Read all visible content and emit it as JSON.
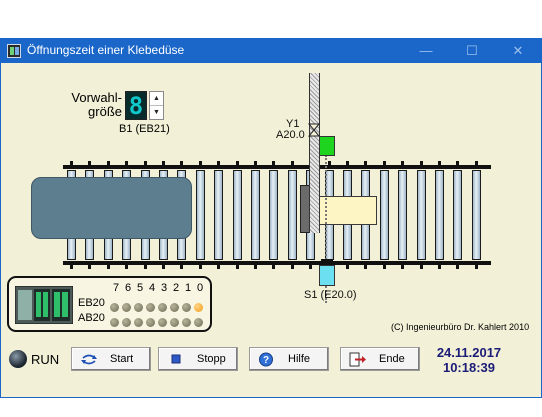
{
  "window": {
    "title": "Öffnungszeit einer Klebedüse",
    "controls": {
      "minimize": "—",
      "maximize": "☐",
      "close": "✕"
    }
  },
  "preset": {
    "label_line1": "Vorwahl-",
    "label_line2": "größe",
    "display_value": "8",
    "spin_up": "▲",
    "spin_down": "▼",
    "input_label": "B1 (EB21)"
  },
  "valve": {
    "name": "Y1",
    "address": "A20.0",
    "lamp_color": "#1fd41f"
  },
  "sensor": {
    "label": "S1 (E20.0)",
    "lamp_color": "#6ce0f0"
  },
  "plc_panel": {
    "bit_labels": [
      "7",
      "6",
      "5",
      "4",
      "3",
      "2",
      "1",
      "0"
    ],
    "rows": [
      {
        "label": "EB20",
        "bits": [
          0,
          0,
          0,
          0,
          0,
          0,
          0,
          1
        ]
      },
      {
        "label": "AB20",
        "bits": [
          0,
          0,
          0,
          0,
          0,
          0,
          0,
          0
        ]
      }
    ],
    "led_on_color": "#f29a12"
  },
  "copyright": "(C) Ingenieurbüro Dr. Kahlert 2010",
  "status": {
    "run_label": "RUN",
    "run_active": false
  },
  "buttons": {
    "start": {
      "label": "Start",
      "icon": "cycle-arrows-icon"
    },
    "stop": {
      "label": "Stopp",
      "icon": "stop-square-icon"
    },
    "help": {
      "label": "Hilfe",
      "icon": "help-icon"
    },
    "exit": {
      "label": "Ende",
      "icon": "exit-door-icon"
    }
  },
  "datetime": {
    "date": "24.11.2017",
    "time": "10:18:39"
  }
}
